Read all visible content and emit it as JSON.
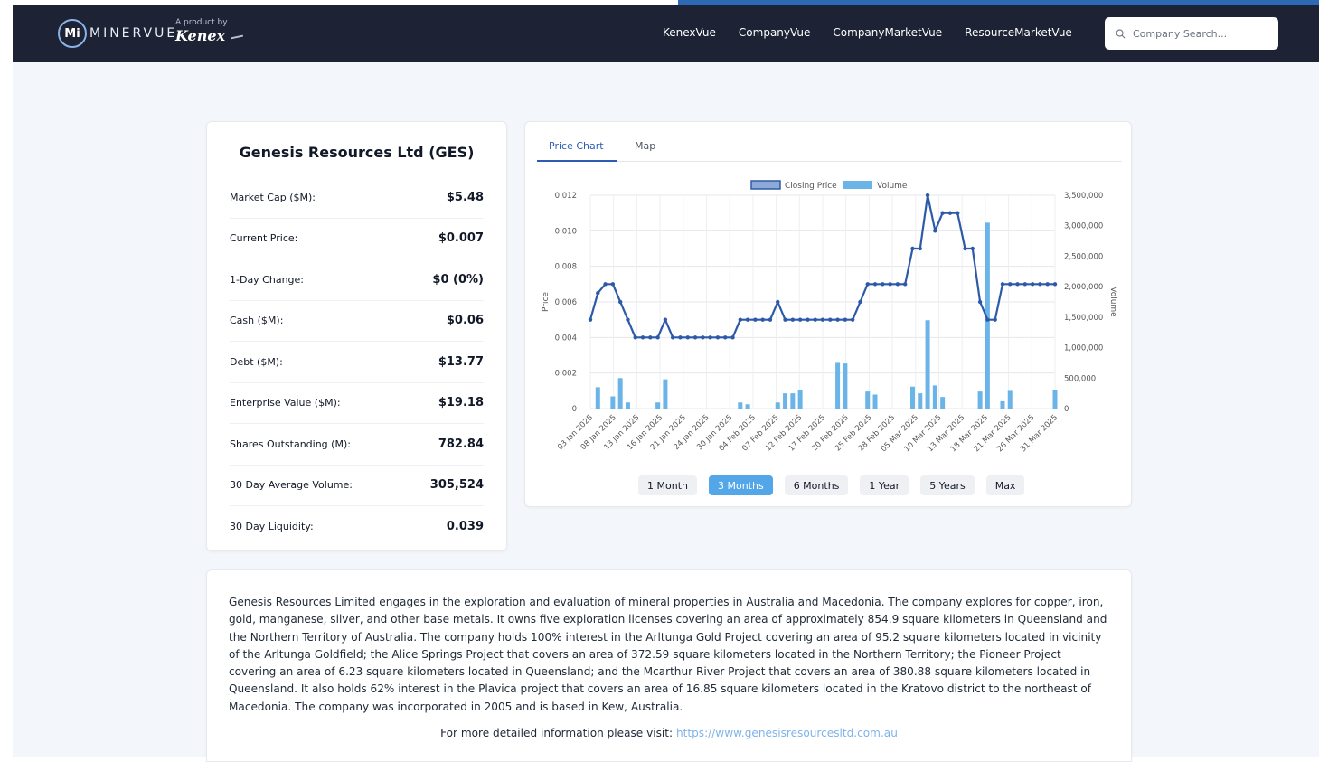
{
  "brand": {
    "logo_text": "MINERVUE",
    "logo_mark": "Mi",
    "product_by": "A product by",
    "kenex": "Kenex"
  },
  "nav": {
    "links": [
      "KenexVue",
      "CompanyVue",
      "CompanyMarketVue",
      "ResourceMarketVue"
    ],
    "search_placeholder": "Company Search..."
  },
  "company": {
    "title": "Genesis Resources Ltd (GES)",
    "stats": [
      {
        "label": "Market Cap ($M):",
        "value": "$5.48"
      },
      {
        "label": "Current Price:",
        "value": "$0.007"
      },
      {
        "label": "1-Day Change:",
        "value": "$0 (0%)"
      },
      {
        "label": "Cash ($M):",
        "value": "$0.06"
      },
      {
        "label": "Debt ($M):",
        "value": "$13.77"
      },
      {
        "label": "Enterprise Value ($M):",
        "value": "$19.18"
      },
      {
        "label": "Shares Outstanding (M):",
        "value": "782.84"
      },
      {
        "label": "30 Day Average Volume:",
        "value": "305,524"
      },
      {
        "label": "30 Day Liquidity:",
        "value": "0.039"
      }
    ]
  },
  "chart_tabs": {
    "price_chart": "Price Chart",
    "map": "Map"
  },
  "range_buttons": [
    "1 Month",
    "3 Months",
    "6 Months",
    "1 Year",
    "5 Years",
    "Max"
  ],
  "active_range": "3 Months",
  "colors": {
    "line": "#2d5aa8",
    "volume": "#6ab4e8",
    "accent": "#53a6e8",
    "navbar": "#1d2235"
  },
  "chart_data": {
    "type": "line",
    "ylabel": "Price",
    "y2label": "Volume",
    "ylim": [
      0,
      0.012
    ],
    "y2lim": [
      0,
      3500000
    ],
    "yticks": [
      "0.012",
      "0.010",
      "0.008",
      "0.006",
      "0.004",
      "0.002",
      "0"
    ],
    "y2ticks": [
      "3,500,000",
      "3,000,000",
      "2,500,000",
      "2,000,000",
      "1,500,000",
      "1,000,000",
      "500,000",
      "0"
    ],
    "xticks": [
      "03 Jan 2025",
      "08 Jan 2025",
      "13 Jan 2025",
      "16 Jan 2025",
      "21 Jan 2025",
      "24 Jan 2025",
      "30 Jan 2025",
      "04 Feb 2025",
      "07 Feb 2025",
      "12 Feb 2025",
      "17 Feb 2025",
      "20 Feb 2025",
      "25 Feb 2025",
      "28 Feb 2025",
      "05 Mar 2025",
      "10 Mar 2025",
      "13 Mar 2025",
      "18 Mar 2025",
      "21 Mar 2025",
      "26 Mar 2025",
      "31 Mar 2025"
    ],
    "legend": [
      "Closing Price",
      "Volume"
    ],
    "legend_position": "top",
    "grid": true,
    "series": [
      {
        "name": "Closing Price",
        "values": [
          0.005,
          0.0065,
          0.007,
          0.007,
          0.006,
          0.005,
          0.004,
          0.004,
          0.004,
          0.004,
          0.005,
          0.004,
          0.004,
          0.004,
          0.004,
          0.004,
          0.004,
          0.004,
          0.004,
          0.004,
          0.005,
          0.005,
          0.005,
          0.005,
          0.005,
          0.006,
          0.005,
          0.005,
          0.005,
          0.005,
          0.005,
          0.005,
          0.005,
          0.005,
          0.005,
          0.005,
          0.006,
          0.007,
          0.007,
          0.007,
          0.007,
          0.007,
          0.007,
          0.009,
          0.009,
          0.012,
          0.01,
          0.011,
          0.011,
          0.011,
          0.009,
          0.009,
          0.006,
          0.005,
          0.005,
          0.007,
          0.007,
          0.007,
          0.007,
          0.007,
          0.007,
          0.007,
          0.007
        ]
      },
      {
        "name": "Volume",
        "values": [
          0,
          350000,
          0,
          200000,
          500000,
          100000,
          0,
          0,
          0,
          100000,
          480000,
          0,
          0,
          0,
          0,
          0,
          0,
          0,
          0,
          0,
          100000,
          70000,
          0,
          0,
          0,
          100000,
          250000,
          250000,
          310000,
          0,
          0,
          0,
          0,
          750000,
          740000,
          0,
          0,
          280000,
          230000,
          0,
          0,
          0,
          0,
          360000,
          250000,
          1450000,
          380000,
          190000,
          0,
          0,
          0,
          0,
          280000,
          3050000,
          0,
          120000,
          290000,
          0,
          0,
          0,
          0,
          0,
          300000
        ]
      }
    ]
  },
  "description": {
    "text": "Genesis Resources Limited engages in the exploration and evaluation of mineral properties in Australia and Macedonia. The company explores for copper, iron, gold, manganese, silver, and other base metals. It owns five exploration licenses covering an area of approximately 854.9 square kilometers in Queensland and the Northern Territory of Australia. The company holds 100% interest in the Arltunga Gold Project covering an area of 95.2 square kilometers located in vicinity of the Arltunga Goldfield; the Alice Springs Project that covers an area of 372.59 square kilometers located in the Northern Territory; the Pioneer Project covering an area of 6.23 square kilometers located in Queensland; and the Mcarthur River Project that covers an area of 380.88 square kilometers located in Queensland. It also holds 62% interest in the Plavica project that covers an area of 16.85 square kilometers located in the Kratovo district to the northeast of Macedonia. The company was incorporated in 2005 and is based in Kew, Australia.",
    "more_info_label": "For more detailed information please visit:",
    "url": "https://www.genesisresourcesltd.com.au"
  }
}
